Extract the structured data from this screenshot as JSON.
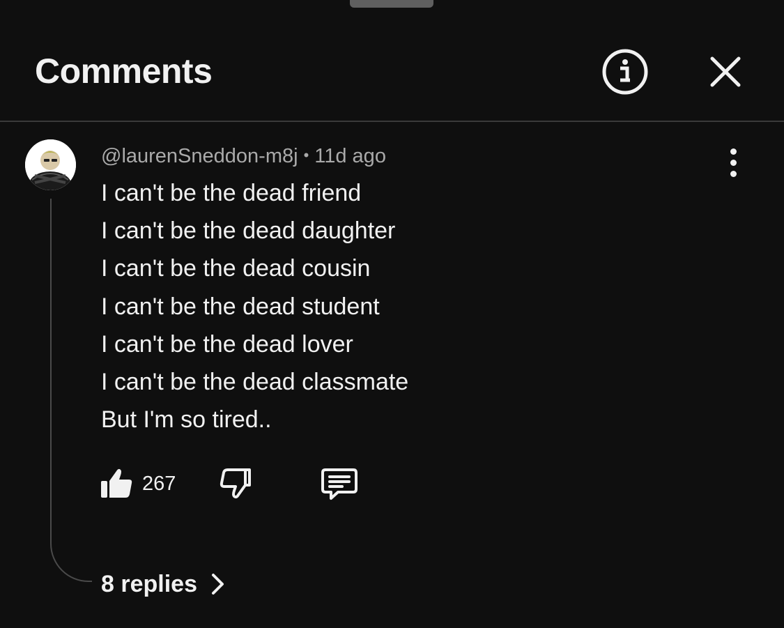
{
  "panel": {
    "title": "Comments",
    "icons": {
      "info": "info-icon",
      "close": "close-icon"
    }
  },
  "comment": {
    "author": "@laurenSneddon-m8j",
    "separator": "•",
    "time": "11d ago",
    "lines": [
      "I can't be the dead friend",
      "I can't be the dead daughter",
      "I can't be the dead cousin",
      "I can't be the dead student",
      "I can't be the dead lover",
      "I can't be the dead classmate",
      "But I'm so tired.."
    ],
    "like_count": "267",
    "replies_label": "8 replies",
    "icons": {
      "like": "thumbs-up-icon",
      "dislike": "thumbs-down-icon",
      "reply": "reply-icon",
      "more": "more-vert-icon",
      "expand": "chevron-right-icon"
    }
  },
  "colors": {
    "background": "#0f0f0f",
    "text": "#f1f1f1",
    "secondary_text": "#aaaaaa",
    "divider": "#3a3a3a"
  }
}
